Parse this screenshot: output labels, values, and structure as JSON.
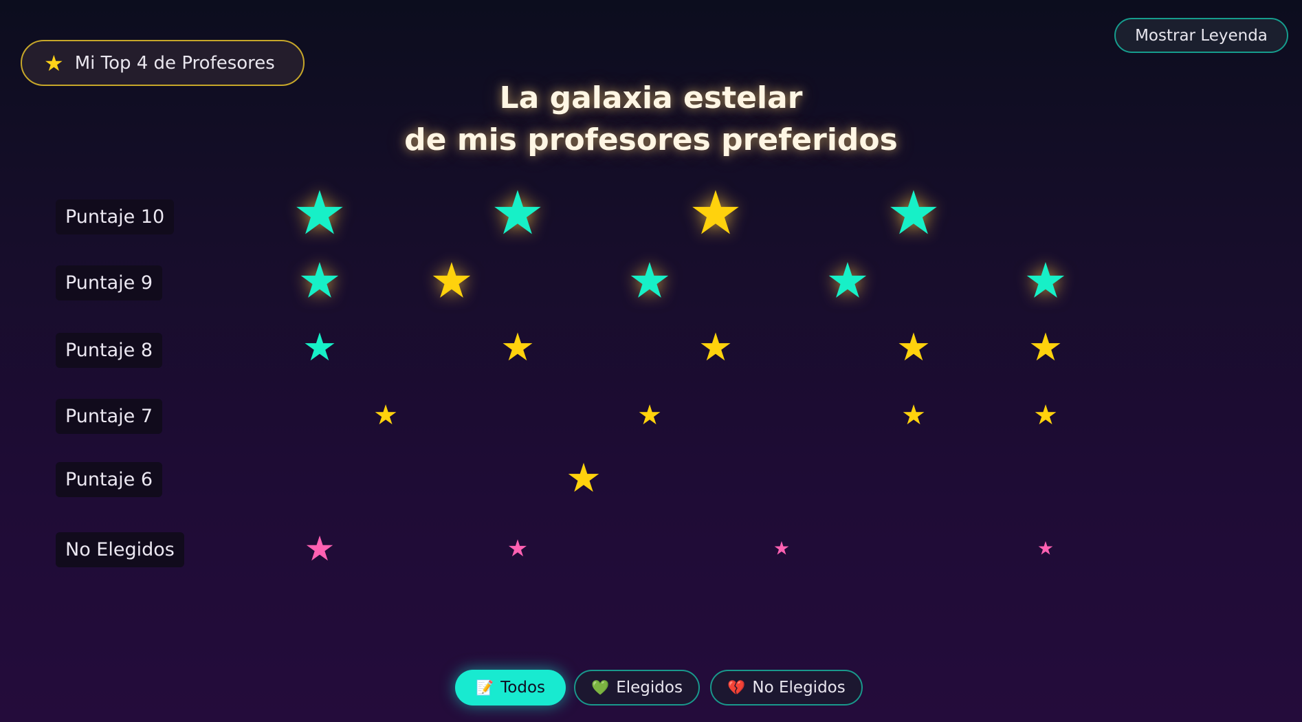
{
  "top_button": {
    "icon": "star-icon",
    "glyph": "★",
    "label": "Mi Top 4 de Profesores"
  },
  "legend_button": {
    "label": "Mostrar Leyenda"
  },
  "title": {
    "line1": "La galaxia estelar",
    "line2": "de mis profesores preferidos"
  },
  "rows": [
    {
      "label": "Puntaje 10"
    },
    {
      "label": "Puntaje 9"
    },
    {
      "label": "Puntaje 8"
    },
    {
      "label": "Puntaje 7"
    },
    {
      "label": "Puntaje 6"
    },
    {
      "label": "No Elegidos"
    }
  ],
  "star_glyph": "★",
  "colors": {
    "teal": "#17f0c7",
    "gold": "#ffd20d",
    "pink": "#ff61b2"
  },
  "filters": [
    {
      "icon": "pencil-icon",
      "glyph": "📝",
      "label": "Todos",
      "active": true
    },
    {
      "icon": "green-heart-icon",
      "glyph": "💚",
      "label": "Elegidos",
      "active": false
    },
    {
      "icon": "broken-heart-icon",
      "glyph": "💔",
      "label": "No Elegidos",
      "active": false
    }
  ]
}
